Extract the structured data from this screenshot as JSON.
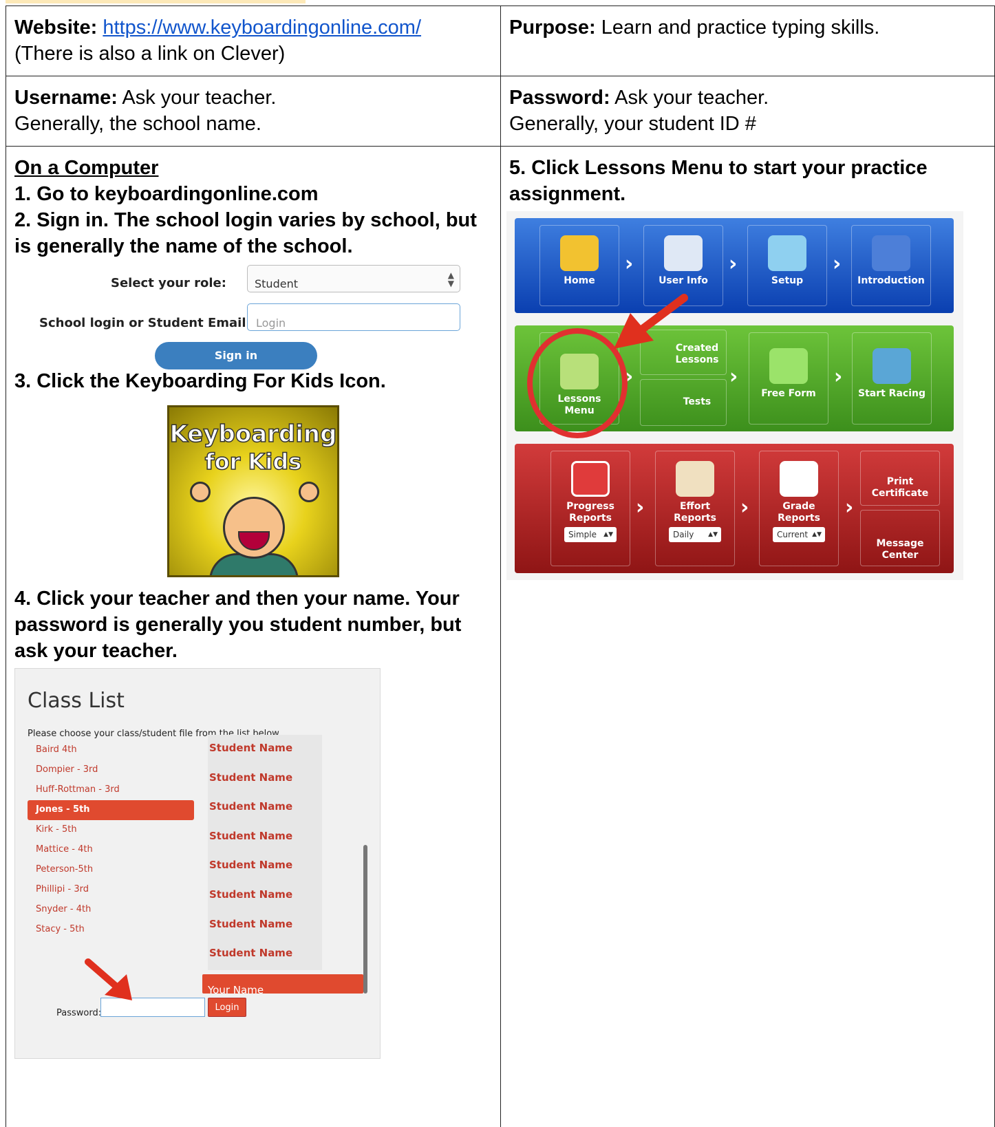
{
  "website": {
    "label": "Website:",
    "url": "https://www.keyboardingonline.com/",
    "note": "(There is also a link on Clever)"
  },
  "purpose": {
    "label": "Purpose:",
    "text": "Learn and practice typing skills."
  },
  "username": {
    "label": "Username:",
    "text": "Ask your teacher.",
    "line2": "Generally, the school name."
  },
  "password": {
    "label": "Password:",
    "text": "Ask your teacher.",
    "line2": "Generally, your student ID #"
  },
  "computer": {
    "heading": "On a Computer",
    "step1": "1. Go to keyboardingonline.com",
    "step2": "2. Sign in. The school login varies by school, but is generally the name of the school.",
    "form": {
      "role_label": "Select your role:",
      "role_value": "Student",
      "login_label": "School login or Student Email",
      "login_placeholder": "Login",
      "signin_label": "Sign in"
    },
    "step3": "3. Click the Keyboarding For Kids Icon.",
    "kids_icon": {
      "line1": "Keyboarding",
      "line2": "for Kids"
    },
    "step4": "4. Click your teacher and then your name. Your password is generally you student number, but ask your teacher.",
    "class_list": {
      "title": "Class List",
      "subtitle": "Please choose your class/student file from the list below.",
      "classes": [
        "Baird 4th",
        "Dompier - 3rd",
        "Huff-Rottman - 3rd",
        "Jones - 5th",
        "Kirk - 5th",
        "Mattice - 4th",
        "Peterson-5th",
        "Phillipi - 3rd",
        "Snyder - 4th",
        "Stacy - 5th"
      ],
      "selected_class": "Jones - 5th",
      "students": [
        "Student Name",
        "Student Name",
        "Student Name",
        "Student Name",
        "Student Name",
        "Student Name",
        "Student Name",
        "Student Name"
      ],
      "your_name": "Your Name",
      "password_label": "Password:",
      "login_button": "Login"
    }
  },
  "step5": {
    "heading": "5. Click Lessons Menu to start your practice assignment.",
    "menu": {
      "blue": [
        "Home",
        "User Info",
        "Setup",
        "Introduction"
      ],
      "green": {
        "lessons_line1": "Lessons",
        "lessons_line2": "Menu",
        "created_line1": "Created",
        "created_line2": "Lessons",
        "tests": "Tests",
        "free_form": "Free Form",
        "start_racing": "Start Racing"
      },
      "red": {
        "progress_line1": "Progress",
        "progress_line2": "Reports",
        "progress_select": "Simple",
        "effort_line1": "Effort",
        "effort_line2": "Reports",
        "effort_select": "Daily",
        "grade_line1": "Grade",
        "grade_line2": "Reports",
        "grade_select": "Current",
        "print_line1": "Print",
        "print_line2": "Certificate",
        "message_line1": "Message",
        "message_line2": "Center"
      }
    }
  },
  "colors": {
    "link": "#1155cc",
    "accent_red": "#e04a2f",
    "signin_blue": "#3b7fbf"
  }
}
